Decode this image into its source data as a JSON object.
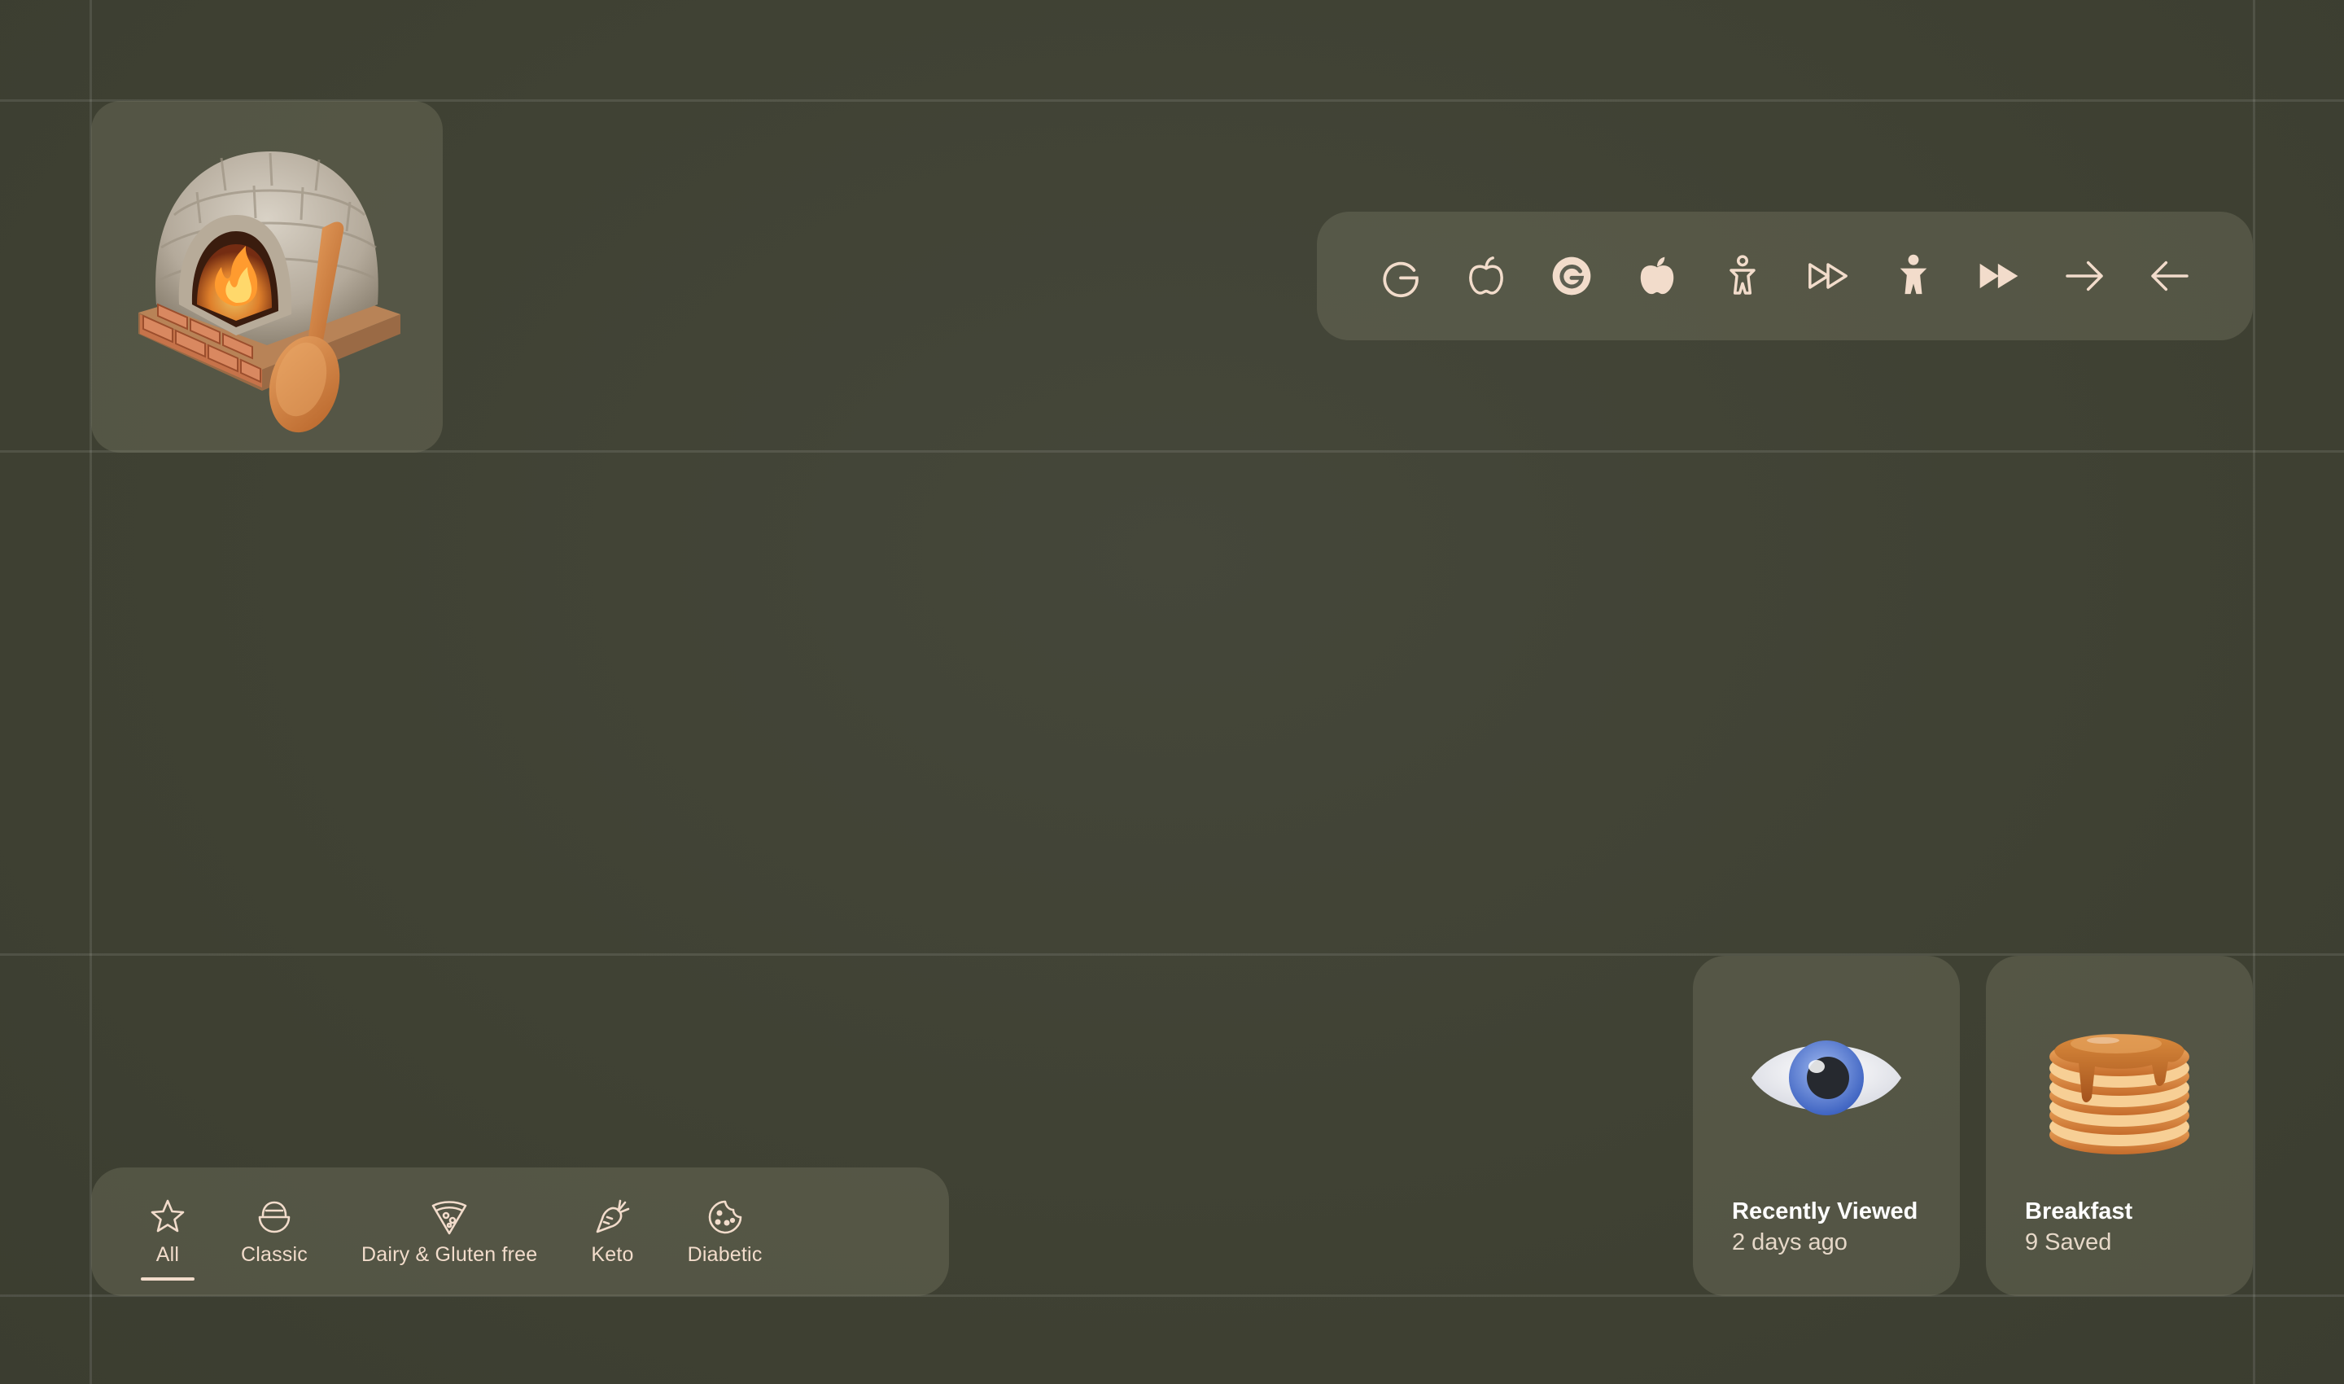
{
  "toolbar": {
    "icons": [
      "google-outline-icon",
      "apple-outline-icon",
      "google-filled-icon",
      "apple-filled-icon",
      "person-outline-icon",
      "fast-forward-outline-icon",
      "person-filled-icon",
      "fast-forward-filled-icon",
      "arrow-right-icon",
      "arrow-left-icon"
    ]
  },
  "nav": {
    "items": [
      {
        "label": "All",
        "icon": "star-icon",
        "selected": true
      },
      {
        "label": "Classic",
        "icon": "bowl-icon",
        "selected": false
      },
      {
        "label": "Dairy & Gluten free",
        "icon": "pizza-slice-icon",
        "selected": false
      },
      {
        "label": "Keto",
        "icon": "carrot-icon",
        "selected": false
      },
      {
        "label": "Diabetic",
        "icon": "cookie-icon",
        "selected": false
      }
    ]
  },
  "collections": [
    {
      "title": "Recently Viewed",
      "subtitle": "2 days ago",
      "icon": "eye-icon"
    },
    {
      "title": "Breakfast",
      "subtitle": "9 Saved",
      "icon": "pancakes-icon"
    }
  ],
  "colors": {
    "background": "#404234",
    "accent": "#f2dccb",
    "card": "#64655a"
  }
}
